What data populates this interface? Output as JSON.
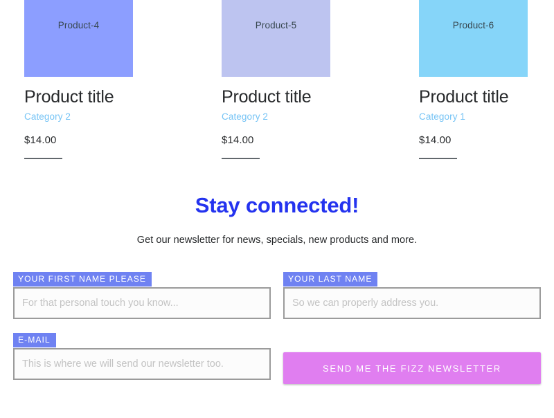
{
  "products": [
    {
      "swatch_label": "Product-4",
      "swatch_color": "#8c9eff",
      "title": "Product title",
      "category": "Category 2",
      "price": "$14.00"
    },
    {
      "swatch_label": "Product-5",
      "swatch_color": "#bdc4f0",
      "title": "Product title",
      "category": "Category 2",
      "price": "$14.00"
    },
    {
      "swatch_label": "Product-6",
      "swatch_color": "#86d5f9",
      "title": "Product title",
      "category": "Category 1",
      "price": "$14.00"
    }
  ],
  "newsletter": {
    "heading": "Stay connected!",
    "subheading": "Get our newsletter for news, specials, new products and more.",
    "heading_color": "#2433ef",
    "fields": [
      {
        "label": "YOUR FIRST NAME PLEASE",
        "placeholder": "For that personal touch you know...",
        "value": ""
      },
      {
        "label": "YOUR LAST NAME",
        "placeholder": "So we can properly address you.",
        "value": ""
      },
      {
        "label": "E-MAIL",
        "placeholder": "This is where we will send our newsletter too.",
        "value": ""
      }
    ],
    "submit_label": "Send me the fizz newsletter",
    "submit_color": "#e07ef0",
    "label_badge_color": "#6f82f2"
  }
}
